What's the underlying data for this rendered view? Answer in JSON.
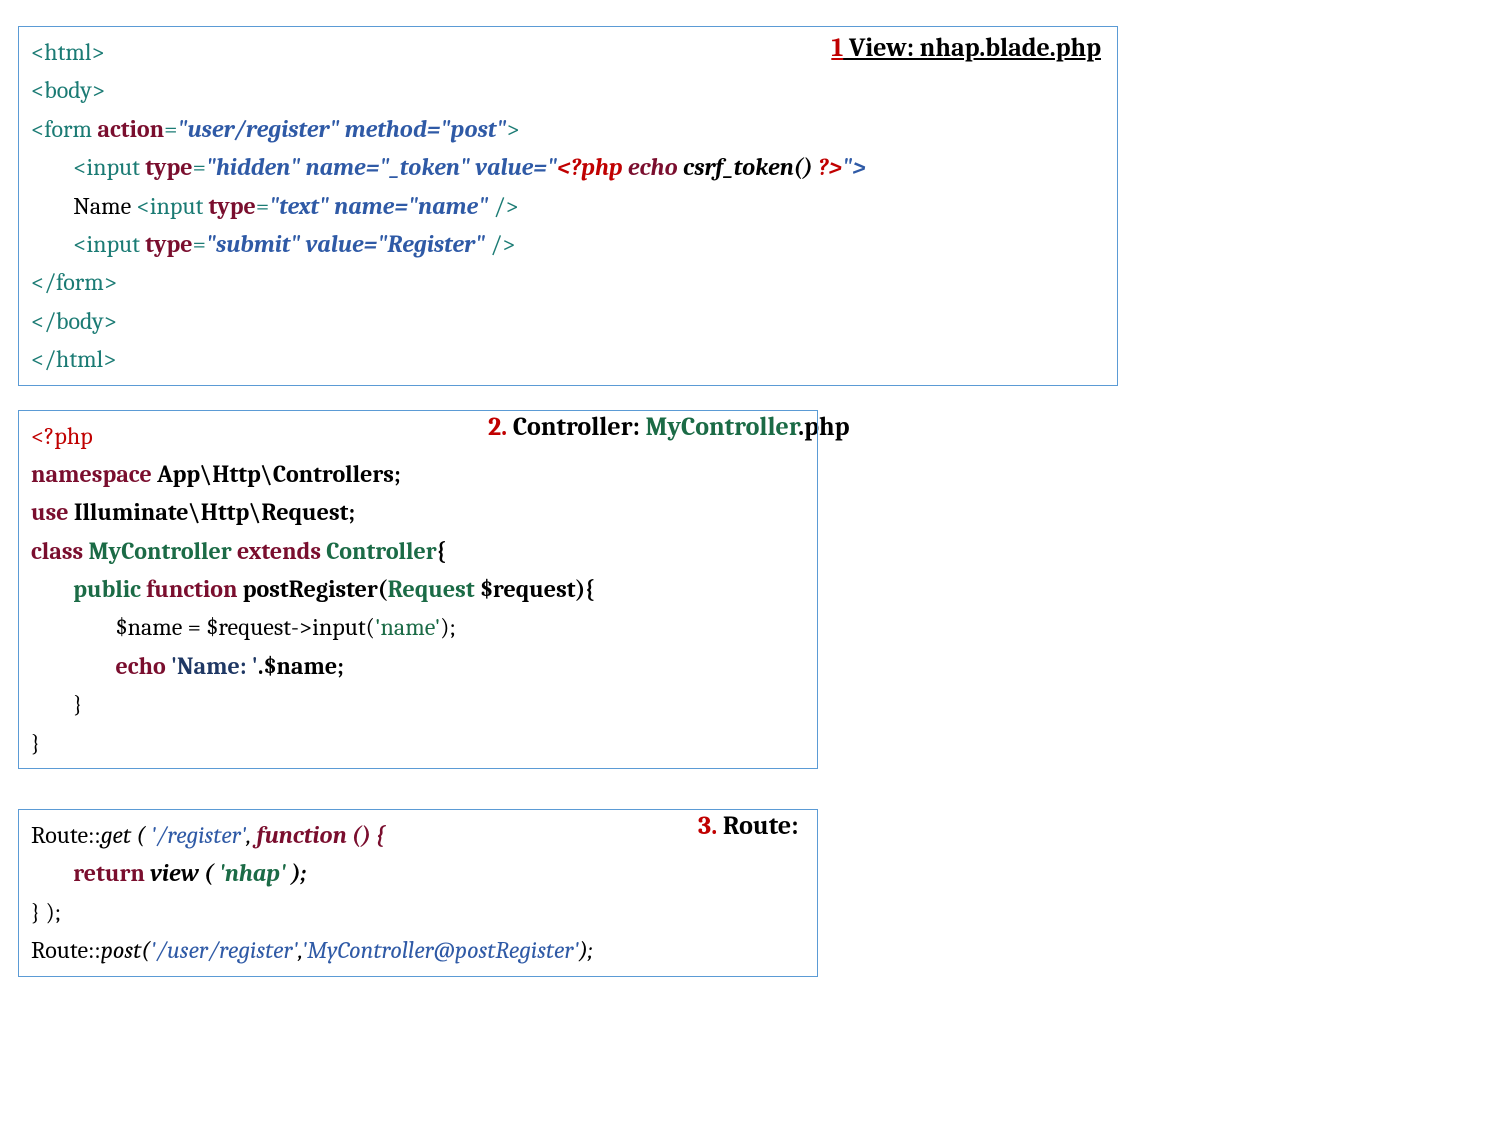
{
  "block1": {
    "title_num": "1",
    "title_rest": " View: nhap.blade.php",
    "l1": "<html>",
    "l2": "<body>",
    "l3_a": "<form ",
    "l3_b": "action",
    "l3_c": "=",
    "l3_d": "\"user/register\" method=\"post\"",
    "l3_e": ">",
    "l4_a": "        <input ",
    "l4_b": "type",
    "l4_c": "=",
    "l4_d": "\"hidden\" name=\"_token\" value=\"",
    "l4_e": "<?php ",
    "l4_f": "echo ",
    "l4_g": "csrf_token() ",
    "l4_h": "?>",
    "l4_i": "\">",
    "l5_a": "        Name ",
    "l5_b": "<input ",
    "l5_c": "type",
    "l5_d": "=",
    "l5_e": "\"text\" name=\"name\" ",
    "l5_f": "/>",
    "l6_a": "        <input ",
    "l6_b": "type",
    "l6_c": "=",
    "l6_d": "\"submit\" value=\"Register\" ",
    "l6_e": "/>",
    "l7": "</form>",
    "l8": "</body>",
    "l9": "</html>"
  },
  "block2": {
    "title_num": "2. ",
    "title_a": "Controller: ",
    "title_b": "MyController",
    "title_c": ".php",
    "l1": "<?php",
    "l2_a": "namespace ",
    "l2_b": "App\\Http\\Controllers;",
    "l3_a": "use ",
    "l3_b": "Illuminate\\Http\\Request;",
    "l4_a": "class ",
    "l4_b": "MyController ",
    "l4_c": "extends ",
    "l4_d": "Controller",
    "l4_e": "{",
    "l5_a": "        public ",
    "l5_b": "function ",
    "l5_c": "postRegister(",
    "l5_d": "Request ",
    "l5_e": "$request){",
    "l6_a": "                $name = $request->input(",
    "l6_b": "'name'",
    "l6_c": ");",
    "l7_a": "                echo ",
    "l7_b": "'Name: '",
    "l7_c": ".$name;",
    "l8": "        }",
    "l9": "}"
  },
  "block3": {
    "title_num": "3. ",
    "title_rest": "Route:",
    "l1_a": "Route::",
    "l1_b": "get ( ",
    "l1_c": "'/register'",
    "l1_d": ", ",
    "l1_e": "function () {",
    "l2_a": "        return ",
    "l2_b": "view ( ",
    "l2_c": "'nhap' ",
    "l2_d": ");",
    "l3": "} );",
    "l4_a": "Route::",
    "l4_b": "post(",
    "l4_c": "'/user/register'",
    "l4_d": ",",
    "l4_e": "'MyController@postRegister'",
    "l4_f": ");"
  }
}
